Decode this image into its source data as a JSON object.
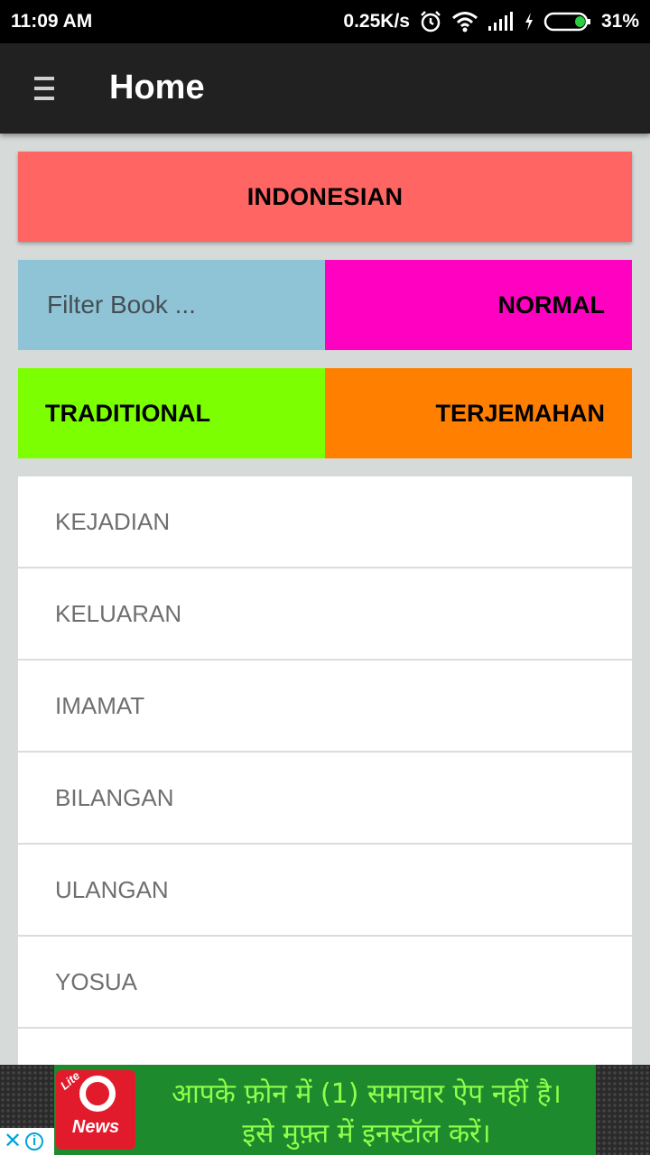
{
  "status_bar": {
    "time": "11:09 AM",
    "net_speed": "0.25K/s",
    "battery_pct": "31%",
    "icons": [
      "alarm-icon",
      "wifi-icon",
      "signal-icon",
      "charging-icon",
      "battery-icon"
    ]
  },
  "app_bar": {
    "title": "Home",
    "menu_icon": "hamburger-menu-icon"
  },
  "controls": {
    "language": "INDONESIAN",
    "filter_placeholder": "Filter Book ...",
    "mode": "NORMAL",
    "script": "TRADITIONAL",
    "translation": "TERJEMAHAN"
  },
  "books": [
    {
      "name": "KEJADIAN"
    },
    {
      "name": "KELUARAN"
    },
    {
      "name": "IMAMAT"
    },
    {
      "name": "BILANGAN"
    },
    {
      "name": "ULANGAN"
    },
    {
      "name": "YOSUA"
    },
    {
      "name": ""
    }
  ],
  "ad": {
    "logo_small_text": "Lite",
    "logo_text": "News",
    "line1": "आपके फ़ोन में (1) समाचार ऐप नहीं है।",
    "line2": "इसे मुफ़्त में इनस्टॉल करें।",
    "close_glyph": "✕",
    "info_glyph": "i"
  },
  "colors": {
    "language_btn": "#ff6562",
    "filter_bg": "#8fc3d6",
    "normal_btn": "#ff02c1",
    "traditional_btn": "#7cff00",
    "terjemahan_btn": "#ff7f00",
    "app_bar": "#212121",
    "background": "#d6dbd9"
  }
}
